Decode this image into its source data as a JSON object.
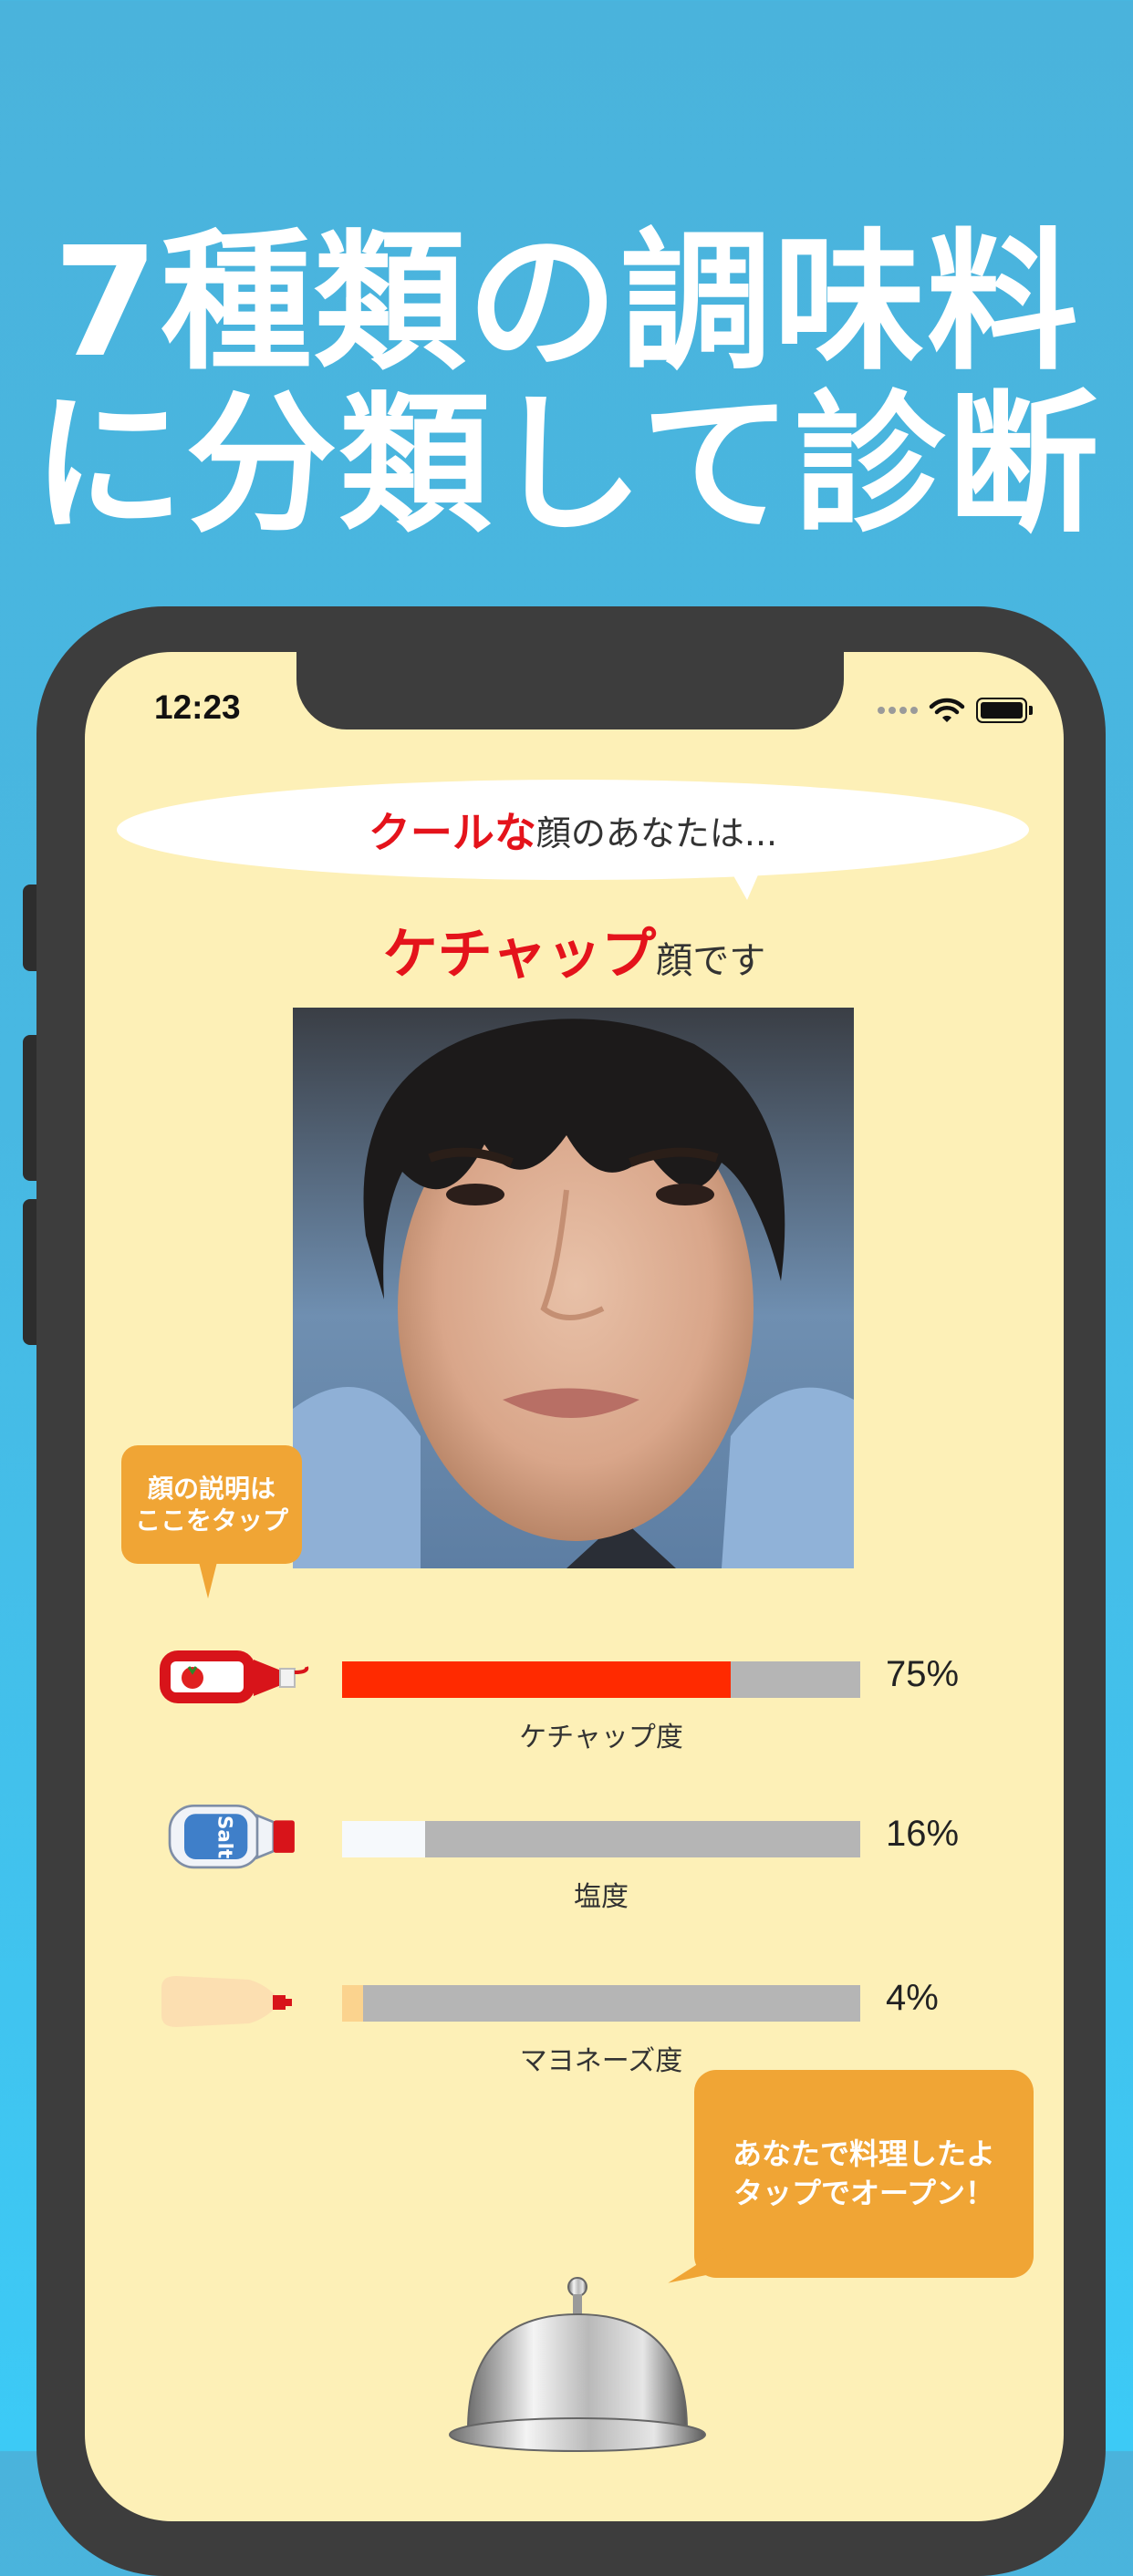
{
  "headline": {
    "line1": "7種類の調味料",
    "line2": "に分類して診断"
  },
  "status": {
    "time": "12:23"
  },
  "result": {
    "intro_highlight": "クールな",
    "intro_rest": "顔のあなたは...",
    "type_highlight": "ケチャップ",
    "type_rest": "顔です"
  },
  "help": {
    "line1": "顔の説明は",
    "line2": "ここをタップ"
  },
  "bars": [
    {
      "label": "ケチャップ度",
      "percent_text": "75%",
      "value": 75,
      "color": "#ff2a00",
      "icon": "ketchup-bottle-icon"
    },
    {
      "label": "塩度",
      "percent_text": "16%",
      "value": 16,
      "color": "#f6f9fc",
      "icon": "salt-shaker-icon"
    },
    {
      "label": "マヨネーズ度",
      "percent_text": "4%",
      "value": 4,
      "color": "#fbd38e",
      "icon": "mayonnaise-bottle-icon"
    }
  ],
  "cta": {
    "line1": "あなたで料理したよ",
    "line2": "タップでオープン！"
  },
  "colors": {
    "accent_red": "#e4131b",
    "orange": "#f0a535",
    "screen_bg": "#fdf0b7",
    "sky": "#4ab3dc"
  }
}
